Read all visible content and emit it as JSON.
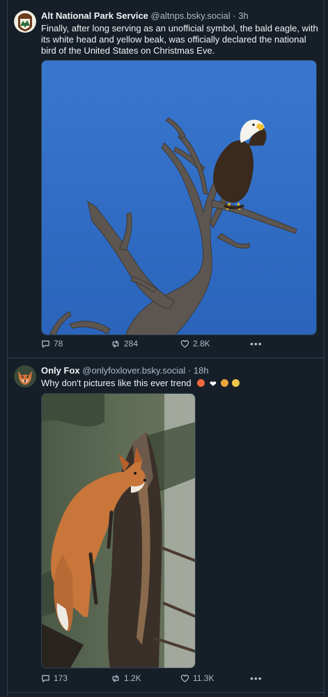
{
  "posts": [
    {
      "author_name": "Alt National Park Service",
      "handle": "@altnps.bsky.social",
      "separator": "·",
      "time": "3h",
      "text": "Finally, after long serving as an unofficial symbol, the bald eagle, with its white head and yellow beak, was officially declared the national bird of the United States on Christmas Eve.",
      "replies": "78",
      "reposts": "284",
      "likes": "2.8K",
      "more_icon": "ellipsis-icon"
    },
    {
      "author_name": "Only Fox",
      "handle": "@onlyfoxlover.bsky.social",
      "separator": "·",
      "time": "18h",
      "text": "Why don't pictures like this ever trend",
      "emojis": [
        "heart-eyes-face",
        "white-heart",
        "cowboy-face",
        "pleading-face"
      ],
      "replies": "173",
      "reposts": "1.2K",
      "likes": "11.3K",
      "more_icon": "ellipsis-icon"
    }
  ],
  "colors": {
    "background": "#161e27",
    "border": "#2e4052",
    "text": "#f1f3f5",
    "muted": "#aebbc9",
    "sky": "#3170c8"
  }
}
